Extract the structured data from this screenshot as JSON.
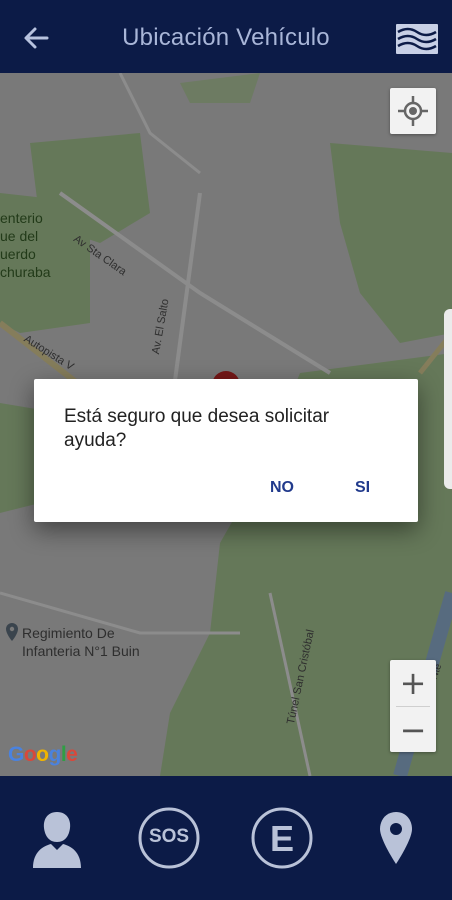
{
  "header": {
    "title": "Ubicación Vehículo"
  },
  "map": {
    "labels": {
      "cementerio": [
        "enterio",
        "ue del",
        "uerdo",
        "churaba"
      ],
      "av_sta_clara": "Av Sta Clara",
      "av_el_salto": "Av. El Salto",
      "autopista": "Autopista V",
      "regimiento_line1": "Regimiento De",
      "regimiento_line2": "Infanteria N°1 Buin",
      "tunel": "Túnel San Cristóbal",
      "costanera": "Costanera Nte"
    },
    "google_logo": "Google"
  },
  "dialog": {
    "message": "Está seguro que desea solicitar ayuda?",
    "no_label": "NO",
    "si_label": "SI"
  },
  "bottom_nav": {
    "sos_label": "SOS",
    "e_label": "E"
  },
  "colors": {
    "bar": "#0c1b47",
    "icon": "#b9c2d8",
    "accent": "#213a8c",
    "park": "#b9dba2"
  }
}
